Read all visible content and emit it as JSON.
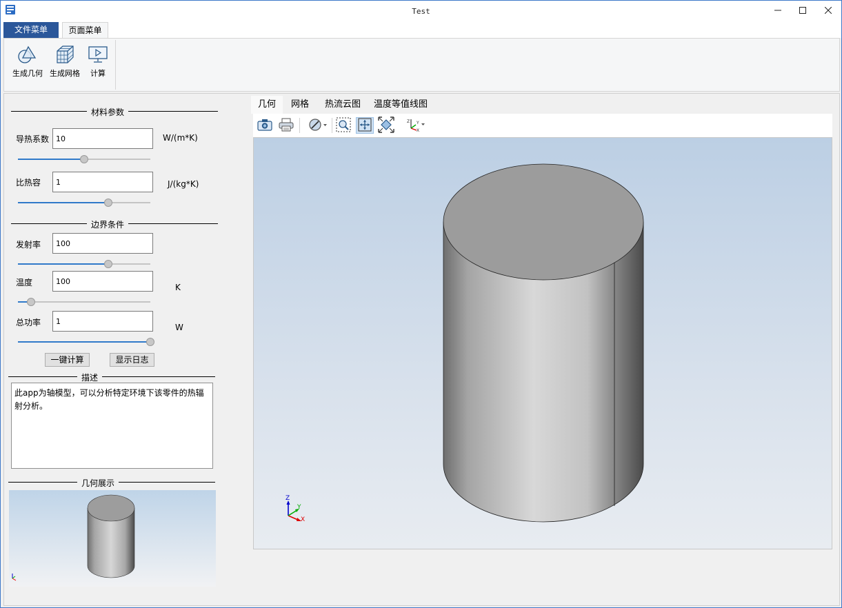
{
  "window": {
    "title": "Test",
    "minimize_icon": "minimize-icon",
    "maximize_icon": "maximize-icon",
    "close_icon": "close-icon"
  },
  "ribbon": {
    "tabs": [
      {
        "label": "文件菜单",
        "active": false
      },
      {
        "label": "页面菜单",
        "active": true
      }
    ],
    "buttons": [
      {
        "label": "生成几何",
        "icon": "geometry-icon"
      },
      {
        "label": "生成网格",
        "icon": "mesh-icon"
      },
      {
        "label": "计算",
        "icon": "compute-icon"
      }
    ]
  },
  "left_panel": {
    "material_header": "材料参数",
    "conductivity": {
      "label": "导热系数",
      "value": "10",
      "unit": "W/(m*K)",
      "slider": 0.5
    },
    "heat_capacity": {
      "label": "比热容",
      "value": "1",
      "unit": "J/(kg*K)",
      "slider": 0.68
    },
    "boundary_header": "边界条件",
    "emissivity": {
      "label": "发射率",
      "value": "100",
      "unit": "",
      "slider": 0.68
    },
    "temperature": {
      "label": "温度",
      "value": "100",
      "unit": "K",
      "slider": 0.1
    },
    "total_power": {
      "label": "总功率",
      "value": "1",
      "unit": "W",
      "slider": 1.0
    },
    "compute_button": "一键计算",
    "log_button": "显示日志",
    "description_header": "描述",
    "description": "此app为轴模型，可以分析特定环境下该零件的热辐射分析。",
    "geometry_header": "几何展示"
  },
  "view": {
    "tabs": [
      {
        "label": "几何",
        "active": true
      },
      {
        "label": "网格",
        "active": false
      },
      {
        "label": "热流云图",
        "active": false
      },
      {
        "label": "温度等值线图",
        "active": false
      }
    ],
    "toolbar": [
      {
        "icon": "camera-icon",
        "pressed": false
      },
      {
        "icon": "print-icon",
        "pressed": false
      },
      {
        "icon": "visibility-toggle-icon",
        "pressed": false
      },
      {
        "icon": "zoom-box-icon",
        "pressed": false
      },
      {
        "icon": "pan-icon",
        "pressed": true
      },
      {
        "icon": "fit-view-icon",
        "pressed": false
      },
      {
        "icon": "axis-view-icon",
        "pressed": false
      }
    ],
    "axes": {
      "x": "X",
      "y": "Y",
      "z": "Z"
    }
  },
  "colors": {
    "accent": "#2b579a",
    "slider_fill": "#2f79c9",
    "viewport_top": "#bccfe4",
    "viewport_bottom": "#e8ecf1"
  }
}
